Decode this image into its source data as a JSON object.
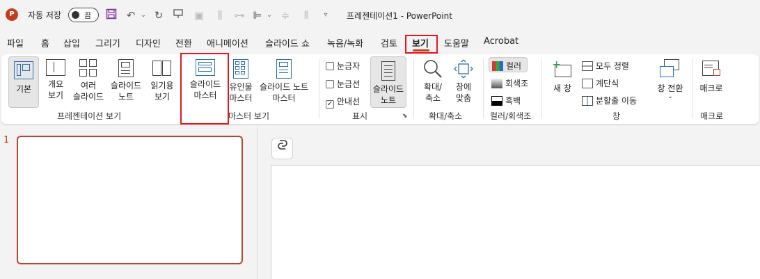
{
  "titlebar": {
    "app_letter": "P",
    "autosave_label": "자동 저장",
    "autosave_state": "끔",
    "doc_title": "프레젠테이션1 - PowerPoint"
  },
  "tabs": [
    "파일",
    "홈",
    "삽입",
    "그리기",
    "디자인",
    "전환",
    "애니메이션",
    "슬라이드 쇼",
    "녹음/녹화",
    "검토",
    "보기",
    "도움말",
    "Acrobat"
  ],
  "active_tab": "보기",
  "ribbon": {
    "presentation_views": {
      "group_label": "프레젠테이션 보기",
      "normal": "기본",
      "outline": "개요 보기",
      "outline_l1": "개요",
      "outline_l2": "보기",
      "sorter_l1": "여러",
      "sorter_l2": "슬라이드",
      "notes_l1": "슬라이드",
      "notes_l2": "노트",
      "reading_l1": "읽기용",
      "reading_l2": "보기"
    },
    "master_views": {
      "group_label": "마스터 보기",
      "slide_master_l1": "슬라이드",
      "slide_master_l2": "마스터",
      "handout_l1": "유인물",
      "handout_l2": "마스터",
      "notes_master_l1": "슬라이드 노트",
      "notes_master_l2": "마스터"
    },
    "show": {
      "group_label": "표시",
      "ruler": "눈금자",
      "gridlines": "눈금선",
      "guides": "안내선",
      "guides_checked": true,
      "notes_l1": "슬라이드",
      "notes_l2": "노트"
    },
    "zoom": {
      "group_label": "확대/축소",
      "zoom_l1": "확대/",
      "zoom_l2": "축소",
      "fit_l1": "창에",
      "fit_l2": "맞춤"
    },
    "color": {
      "group_label": "컬러/회색조",
      "color": "컬러",
      "grayscale": "회색조",
      "bw": "흑백"
    },
    "window": {
      "group_label": "창",
      "new_window": "새 창",
      "arrange_all": "모두 정렬",
      "cascade": "계단식",
      "move_split": "분할줄 이동",
      "switch_windows": "창 전환"
    },
    "macros": {
      "group_label": "매크로",
      "macros": "매크로"
    }
  },
  "slides": {
    "numbers": [
      "1"
    ]
  },
  "colors": {
    "accent": "#c43e1c",
    "highlight": "#e8141c"
  }
}
